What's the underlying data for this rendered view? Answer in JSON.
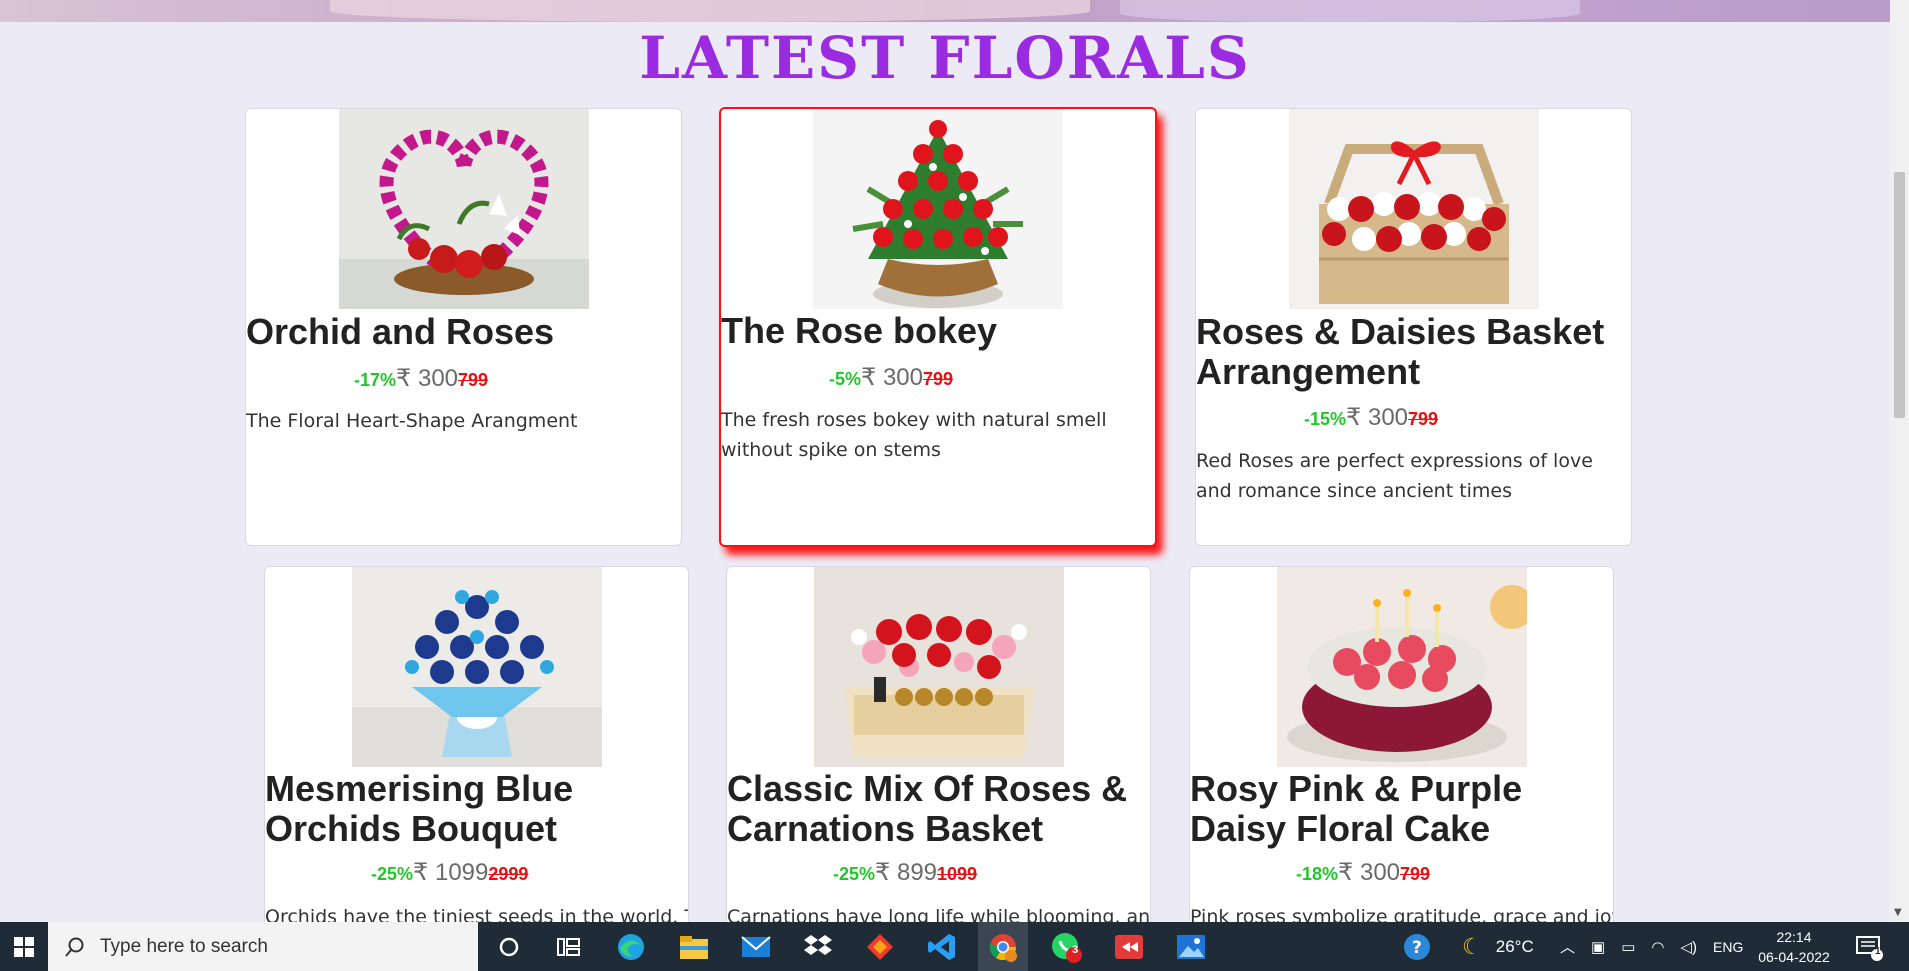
{
  "section": {
    "title": "LATEST FLORALS"
  },
  "products": [
    {
      "title": "Orchid and Roses",
      "discount": "-17%",
      "price": "₹ 300",
      "old_price": "799",
      "description": "The Floral Heart-Shape Arangment"
    },
    {
      "title": "The Rose bokey",
      "discount": "-5%",
      "price": "₹ 300",
      "old_price": "799",
      "description": "The fresh roses bokey with natural smell without spike on stems"
    },
    {
      "title": "Roses & Daisies Basket Arrangement",
      "discount": "-15%",
      "price": "₹ 300",
      "old_price": "799",
      "description": "Red Roses are perfect expressions of love and romance since ancient times"
    },
    {
      "title": "Mesmerising Blue Orchids Bouquet",
      "discount": "-25%",
      "price": "₹ 1099",
      "old_price": "2999",
      "description": "Orchids have the tiniest seeds in the world. This"
    },
    {
      "title": "Classic Mix Of Roses & Carnations Basket",
      "discount": "-25%",
      "price": "₹ 899",
      "old_price": "1099",
      "description": "Carnations have long life while blooming, and"
    },
    {
      "title": "Rosy Pink & Purple Daisy Floral Cake",
      "discount": "-18%",
      "price": "₹ 300",
      "old_price": "799",
      "description": "Pink roses symbolize gratitude, grace and joy"
    }
  ],
  "taskbar": {
    "search_placeholder": "Type here to search",
    "weather": "26°C",
    "language": "ENG",
    "time": "22:14",
    "date": "06-04-2022",
    "whatsapp_badge": "3",
    "notification_count": "1"
  }
}
